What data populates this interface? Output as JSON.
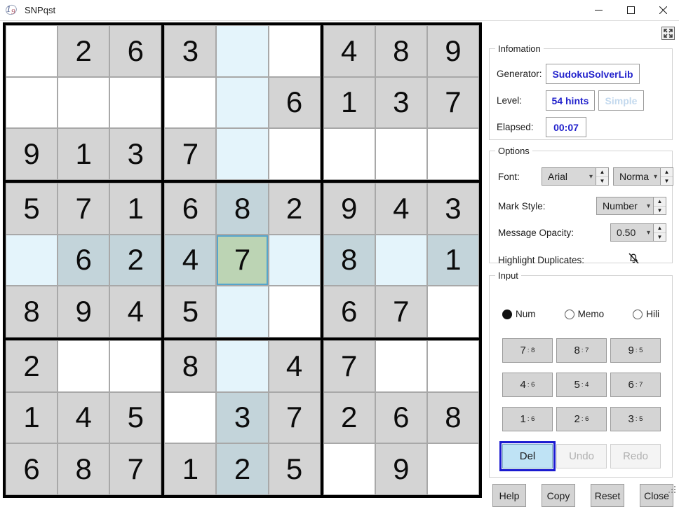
{
  "window": {
    "title": "SNPqst",
    "icon": "sudoku-app-icon",
    "minimize": "minimize-icon",
    "maximize": "maximize-icon",
    "close": "close-icon"
  },
  "board": {
    "selected_cell": {
      "row": 4,
      "col": 4,
      "value": "7"
    },
    "highlight_row": 4,
    "highlight_col": 4,
    "colors": {
      "given_bg": "#d4d4d4",
      "empty_bg": "#ffffff",
      "highlight_empty_bg": "#e4f4fb",
      "highlight_given_bg": "#c3d4da",
      "selected_bg": "#bcd4b4",
      "selected_border": "#56a5cc",
      "grid_line": "#000000"
    },
    "cells": [
      [
        "",
        "2",
        "6",
        "3",
        "",
        "",
        "4",
        "8",
        "9"
      ],
      [
        "",
        "",
        "",
        "",
        "",
        "6",
        "1",
        "3",
        "7"
      ],
      [
        "9",
        "1",
        "3",
        "7",
        "",
        "",
        "",
        "",
        ""
      ],
      [
        "5",
        "7",
        "1",
        "6",
        "8",
        "2",
        "9",
        "4",
        "3"
      ],
      [
        "",
        "6",
        "2",
        "4",
        "7",
        "",
        "8",
        "",
        "1"
      ],
      [
        "8",
        "9",
        "4",
        "5",
        "",
        "",
        "6",
        "7",
        ""
      ],
      [
        "2",
        "",
        "",
        "8",
        "",
        "4",
        "7",
        "",
        ""
      ],
      [
        "1",
        "4",
        "5",
        "",
        "3",
        "7",
        "2",
        "6",
        "8"
      ],
      [
        "6",
        "8",
        "7",
        "1",
        "2",
        "5",
        "",
        "9",
        ""
      ]
    ]
  },
  "information": {
    "legend": "Infomation",
    "expand_icon": "collapse-arrows-icon",
    "generator_label": "Generator:",
    "generator_value": "SudokuSolverLib",
    "level_label": "Level:",
    "level_hints": "54 hints",
    "level_difficulty": "Simple",
    "elapsed_label": "Elapsed:",
    "elapsed_value": "00:07"
  },
  "options": {
    "legend": "Options",
    "font_label": "Font:",
    "font_family": "Arial",
    "font_style": "Norma",
    "mark_style_label": "Mark Style:",
    "mark_style": "Number",
    "message_opacity_label": "Message Opacity:",
    "message_opacity": "0.50",
    "highlight_duplicates_label": "Highlight Duplicates:",
    "highlight_duplicates_icon": "bell-off-icon"
  },
  "input": {
    "legend": "Input",
    "modes": [
      {
        "label": "Num",
        "selected": true
      },
      {
        "label": "Memo",
        "selected": false
      },
      {
        "label": "Hili",
        "selected": false
      }
    ],
    "numpad": [
      {
        "num": "7",
        "count": ": 8"
      },
      {
        "num": "8",
        "count": ": 7"
      },
      {
        "num": "9",
        "count": ": 5"
      },
      {
        "num": "4",
        "count": ": 6"
      },
      {
        "num": "5",
        "count": ": 4"
      },
      {
        "num": "6",
        "count": ": 7"
      },
      {
        "num": "1",
        "count": ": 6"
      },
      {
        "num": "2",
        "count": ": 6"
      },
      {
        "num": "3",
        "count": ": 5"
      }
    ],
    "del_label": "Del",
    "undo_label": "Undo",
    "redo_label": "Redo"
  },
  "footer": {
    "help": "Help",
    "copy": "Copy",
    "reset": "Reset",
    "close": "Close"
  }
}
